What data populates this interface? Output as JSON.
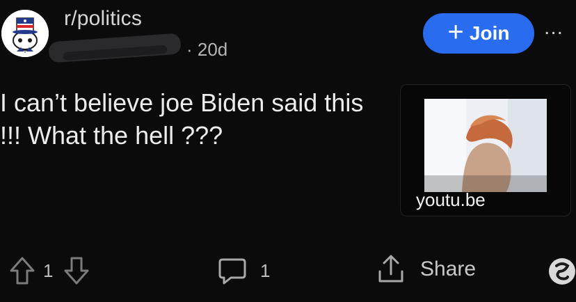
{
  "header": {
    "subreddit": "r/politics",
    "meta_dots": "· ·",
    "age": "· 20d",
    "join_label": "Join",
    "join_icon": "+",
    "more_label": "...",
    "accent_color": "#2a6cf0"
  },
  "post": {
    "title": "I can’t believe joe Biden said this !!! What the hell ???",
    "link": {
      "domain": "youtu.be",
      "thumbnail": "video-thumbnail"
    }
  },
  "actions": {
    "vote_count": "1",
    "comment_count": "1",
    "share_label": "Share",
    "icons": [
      "upvote-icon",
      "downvote-icon",
      "comment-icon",
      "share-icon",
      "award-icon"
    ]
  }
}
